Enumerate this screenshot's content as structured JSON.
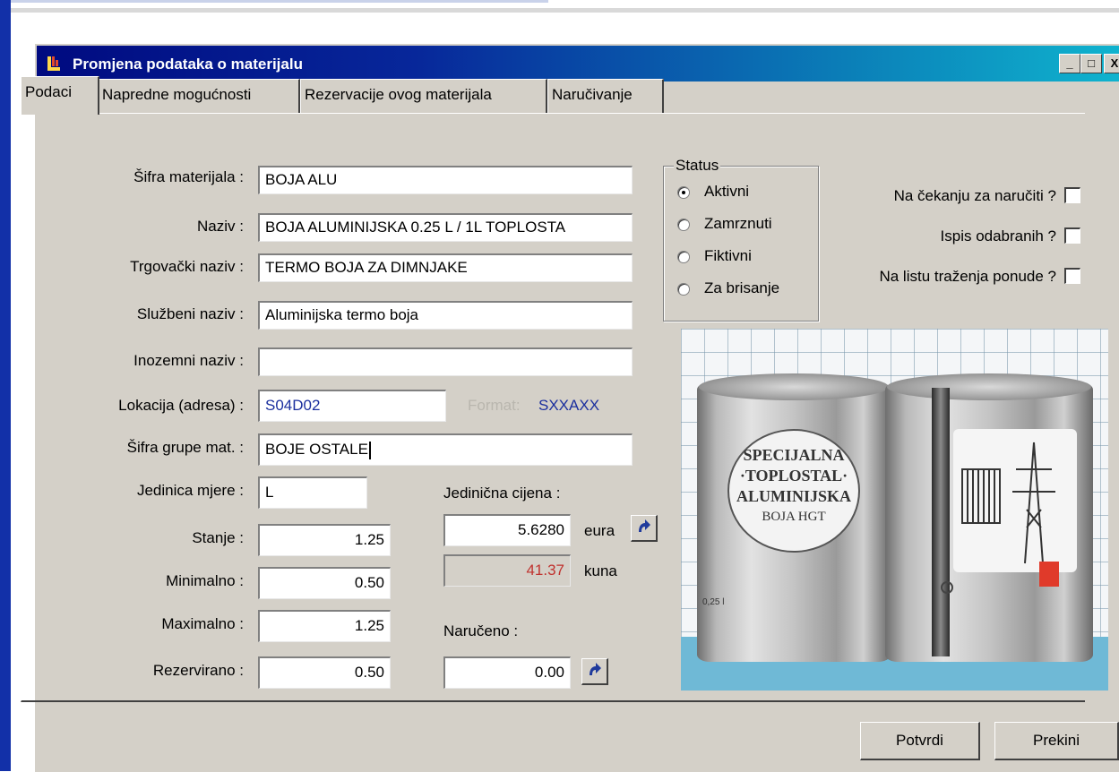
{
  "window": {
    "title": "Promjena podataka o materijalu",
    "minimize": "_",
    "maximize": "□",
    "close": "X"
  },
  "tabs": [
    {
      "label": "Podaci",
      "active": true
    },
    {
      "label": "Napredne mogućnosti",
      "active": false
    },
    {
      "label": "Rezervacije ovog materijala",
      "active": false
    },
    {
      "label": "Naručivanje",
      "active": false
    }
  ],
  "form": {
    "sifra_materijala": {
      "label": "Šifra materijala :",
      "value": "BOJA ALU"
    },
    "naziv": {
      "label": "Naziv :",
      "value": "BOJA ALUMINIJSKA 0.25 L / 1L TOPLOSTA"
    },
    "trgovacki_naziv": {
      "label": "Trgovački naziv :",
      "value": "TERMO BOJA ZA DIMNJAKE"
    },
    "sluzbeni_naziv": {
      "label": "Službeni naziv :",
      "value": "Aluminijska termo boja"
    },
    "inozemni_naziv": {
      "label": "Inozemni naziv :",
      "value": ""
    },
    "lokacija": {
      "label": "Lokacija (adresa) :",
      "value": "S04D02",
      "format_label": "Format:",
      "format_value": "SXXAXX"
    },
    "sifra_grupe": {
      "label": "Šifra grupe mat. :",
      "value": "BOJE OSTALE"
    },
    "jedinica_mjere": {
      "label": "Jedinica mjere :",
      "value": "L"
    },
    "stanje": {
      "label": "Stanje :",
      "value": "1.25"
    },
    "minimalno": {
      "label": "Minimalno :",
      "value": "0.50"
    },
    "maximalno": {
      "label": "Maximalno :",
      "value": "1.25"
    },
    "rezervirano": {
      "label": "Rezervirano :",
      "value": "0.50"
    },
    "jedinicna_cijena": {
      "label": "Jedinična cijena :",
      "eur_value": "5.6280",
      "eur_unit": "eura",
      "kn_value": "41.37",
      "kn_unit": "kuna"
    },
    "naruceno": {
      "label": "Naručeno :",
      "value": "0.00"
    }
  },
  "status": {
    "legend": "Status",
    "options": [
      {
        "label": "Aktivni",
        "selected": true
      },
      {
        "label": "Zamrznuti",
        "selected": false
      },
      {
        "label": "Fiktivni",
        "selected": false
      },
      {
        "label": "Za brisanje",
        "selected": false
      }
    ]
  },
  "checkboxes": [
    {
      "label": "Na čekanju za naručiti ?",
      "checked": false
    },
    {
      "label": "Ispis odabranih ?",
      "checked": false
    },
    {
      "label": "Na listu traženja ponude ?",
      "checked": false
    }
  ],
  "product_image": {
    "label_lines": [
      "SPECIJALNA",
      "·TOPLOSTAL·",
      "ALUMINIJSKA",
      "BOJA HGT"
    ],
    "can_volume": "0,25 l"
  },
  "buttons": {
    "confirm": "Potvrdi",
    "cancel": "Prekini"
  },
  "colors": {
    "title_start": "#000a80",
    "title_end": "#0fb3ce",
    "face": "#d4d0c8",
    "kuna_value": "#c0322e",
    "location_value": "#1b2f9e"
  }
}
